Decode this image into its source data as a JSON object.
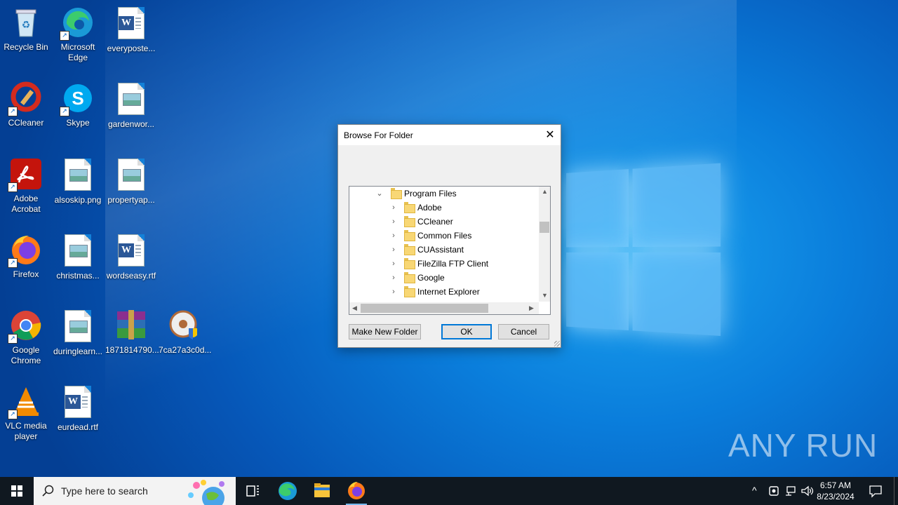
{
  "desktop": {
    "icons": [
      {
        "label": "Recycle Bin"
      },
      {
        "label": "Microsoft Edge"
      },
      {
        "label": "everyposte..."
      },
      {
        "label": "CCleaner"
      },
      {
        "label": "Skype"
      },
      {
        "label": "gardenwor..."
      },
      {
        "label": "Adobe Acrobat"
      },
      {
        "label": "alsoskip.png"
      },
      {
        "label": "propertyap..."
      },
      {
        "label": "Firefox"
      },
      {
        "label": "christmas..."
      },
      {
        "label": "wordseasy.rtf"
      },
      {
        "label": "Google Chrome"
      },
      {
        "label": "duringlearn..."
      },
      {
        "label": "1871814790..."
      },
      {
        "label": "7ca27a3c0d..."
      },
      {
        "label": "VLC media player"
      },
      {
        "label": "eurdead.rtf"
      }
    ]
  },
  "dialog": {
    "title": "Browse For Folder",
    "tree": {
      "parent": "Program Files",
      "children": [
        "Adobe",
        "CCleaner",
        "Common Files",
        "CUAssistant",
        "FileZilla FTP Client",
        "Google",
        "Internet Explorer"
      ]
    },
    "buttons": {
      "make_new_folder": "Make New Folder",
      "ok": "OK",
      "cancel": "Cancel"
    }
  },
  "taskbar": {
    "search_placeholder": "Type here to search",
    "time": "6:57 AM",
    "date": "8/23/2024"
  },
  "watermark": "ANY RUN",
  "colors": {
    "desktop_blue": "#0a7ddb",
    "taskbar": "#101820",
    "accent": "#0078d7"
  }
}
